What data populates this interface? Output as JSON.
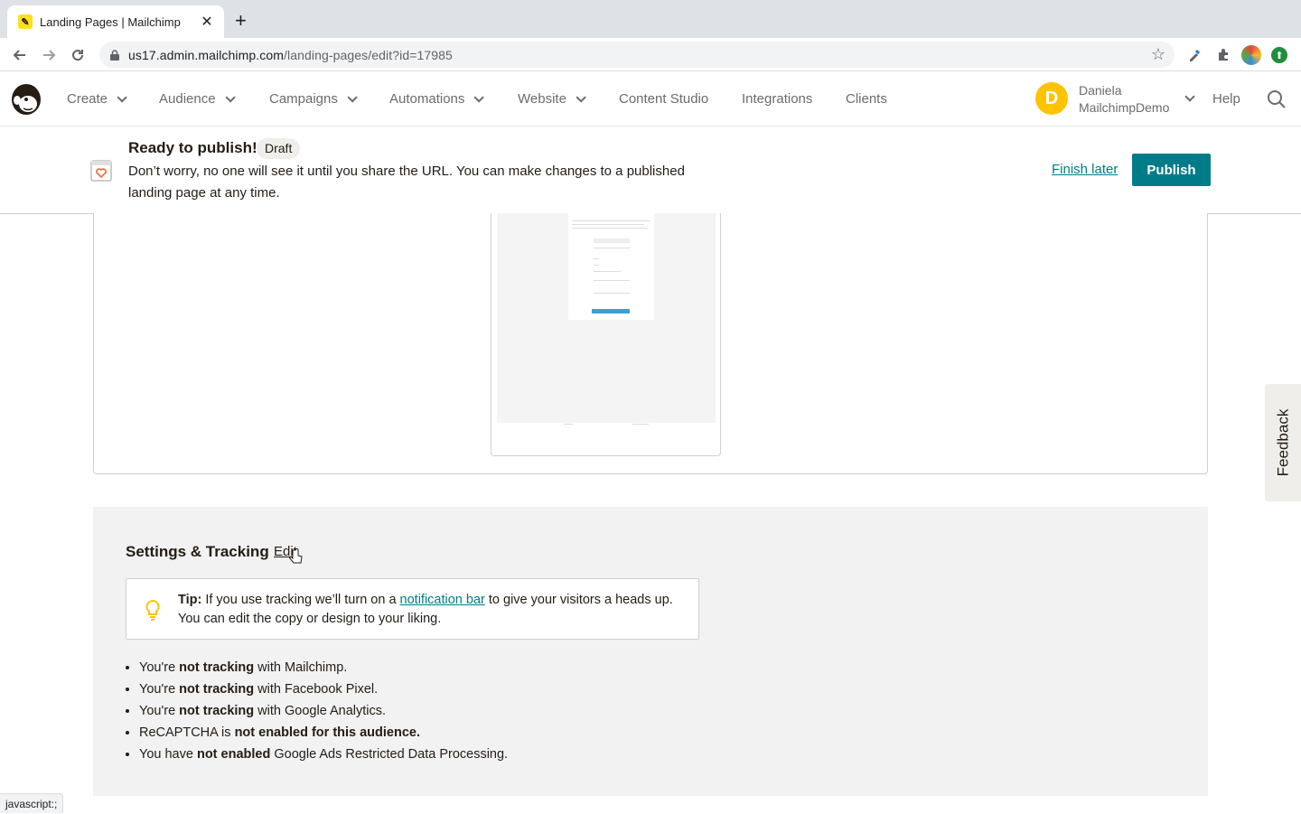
{
  "browser": {
    "tab_title": "Landing Pages | Mailchimp",
    "url_host": "us17.admin.mailchimp.com",
    "url_path": "/landing-pages/edit?id=17985",
    "status_text": "javascript:;"
  },
  "nav": {
    "items": [
      {
        "label": "Create",
        "has_menu": true
      },
      {
        "label": "Audience",
        "has_menu": true
      },
      {
        "label": "Campaigns",
        "has_menu": true
      },
      {
        "label": "Automations",
        "has_menu": true
      },
      {
        "label": "Website",
        "has_menu": true
      },
      {
        "label": "Content Studio",
        "has_menu": false
      },
      {
        "label": "Integrations",
        "has_menu": false
      },
      {
        "label": "Clients",
        "has_menu": false
      }
    ],
    "avatar_initial": "D",
    "user_first": "Daniela",
    "user_last": "MailchimpDemo",
    "help_label": "Help"
  },
  "banner": {
    "title": "Ready to publish!",
    "status_badge": "Draft",
    "message": "Don’t worry, no one will see it until you share the URL. You can make changes to a published landing page at any time.",
    "finish_later_label": "Finish later",
    "publish_label": "Publish"
  },
  "settings": {
    "title": "Settings & Tracking",
    "edit_label": "Edit",
    "tip_label": "Tip:",
    "tip_before_link": " If you use tracking we’ll turn on a ",
    "tip_link": "notification bar",
    "tip_after_link": " to give your visitors a heads up. You can edit the copy or design to your liking.",
    "tracking_items": [
      {
        "pre": "You're ",
        "bold": "not tracking",
        "post": " with Mailchimp."
      },
      {
        "pre": "You're ",
        "bold": "not tracking",
        "post": " with Facebook Pixel."
      },
      {
        "pre": "You're ",
        "bold": "not tracking",
        "post": " with Google Analytics."
      },
      {
        "pre": "ReCAPTCHA is ",
        "bold": "not enabled for this audience.",
        "post": ""
      },
      {
        "pre": "You have ",
        "bold": "not enabled",
        "post": " Google Ads Restricted Data Processing."
      }
    ]
  },
  "feedback_label": "Feedback",
  "colors": {
    "brand_teal": "#007c89",
    "avatar_yellow": "#ffc300",
    "mailchimp_yellow": "#ffe01b"
  }
}
